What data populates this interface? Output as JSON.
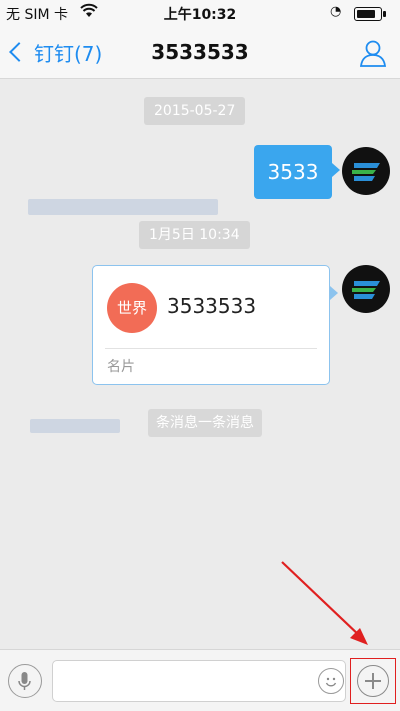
{
  "status_bar": {
    "carrier": "无 SIM 卡",
    "time": "上午10:32"
  },
  "navbar": {
    "back_label": "钉钉(7)",
    "title": "3533533"
  },
  "messages": {
    "date_1": "2015-05-27",
    "text_message": "3533",
    "date_2": "1月5日 10:34",
    "card": {
      "badge": "世界",
      "name": "3533533",
      "type_label": "名片"
    },
    "system_notice": "条消息一条消息"
  },
  "colors": {
    "accent": "#1e8cf0",
    "bubble": "#3aa6ee",
    "card_badge": "#f26c56",
    "annotation": "#e02020"
  },
  "icons": {
    "profile": "person-outline-icon",
    "mic": "microphone-icon",
    "emoji": "smiley-icon",
    "more": "plus-circle-icon"
  }
}
